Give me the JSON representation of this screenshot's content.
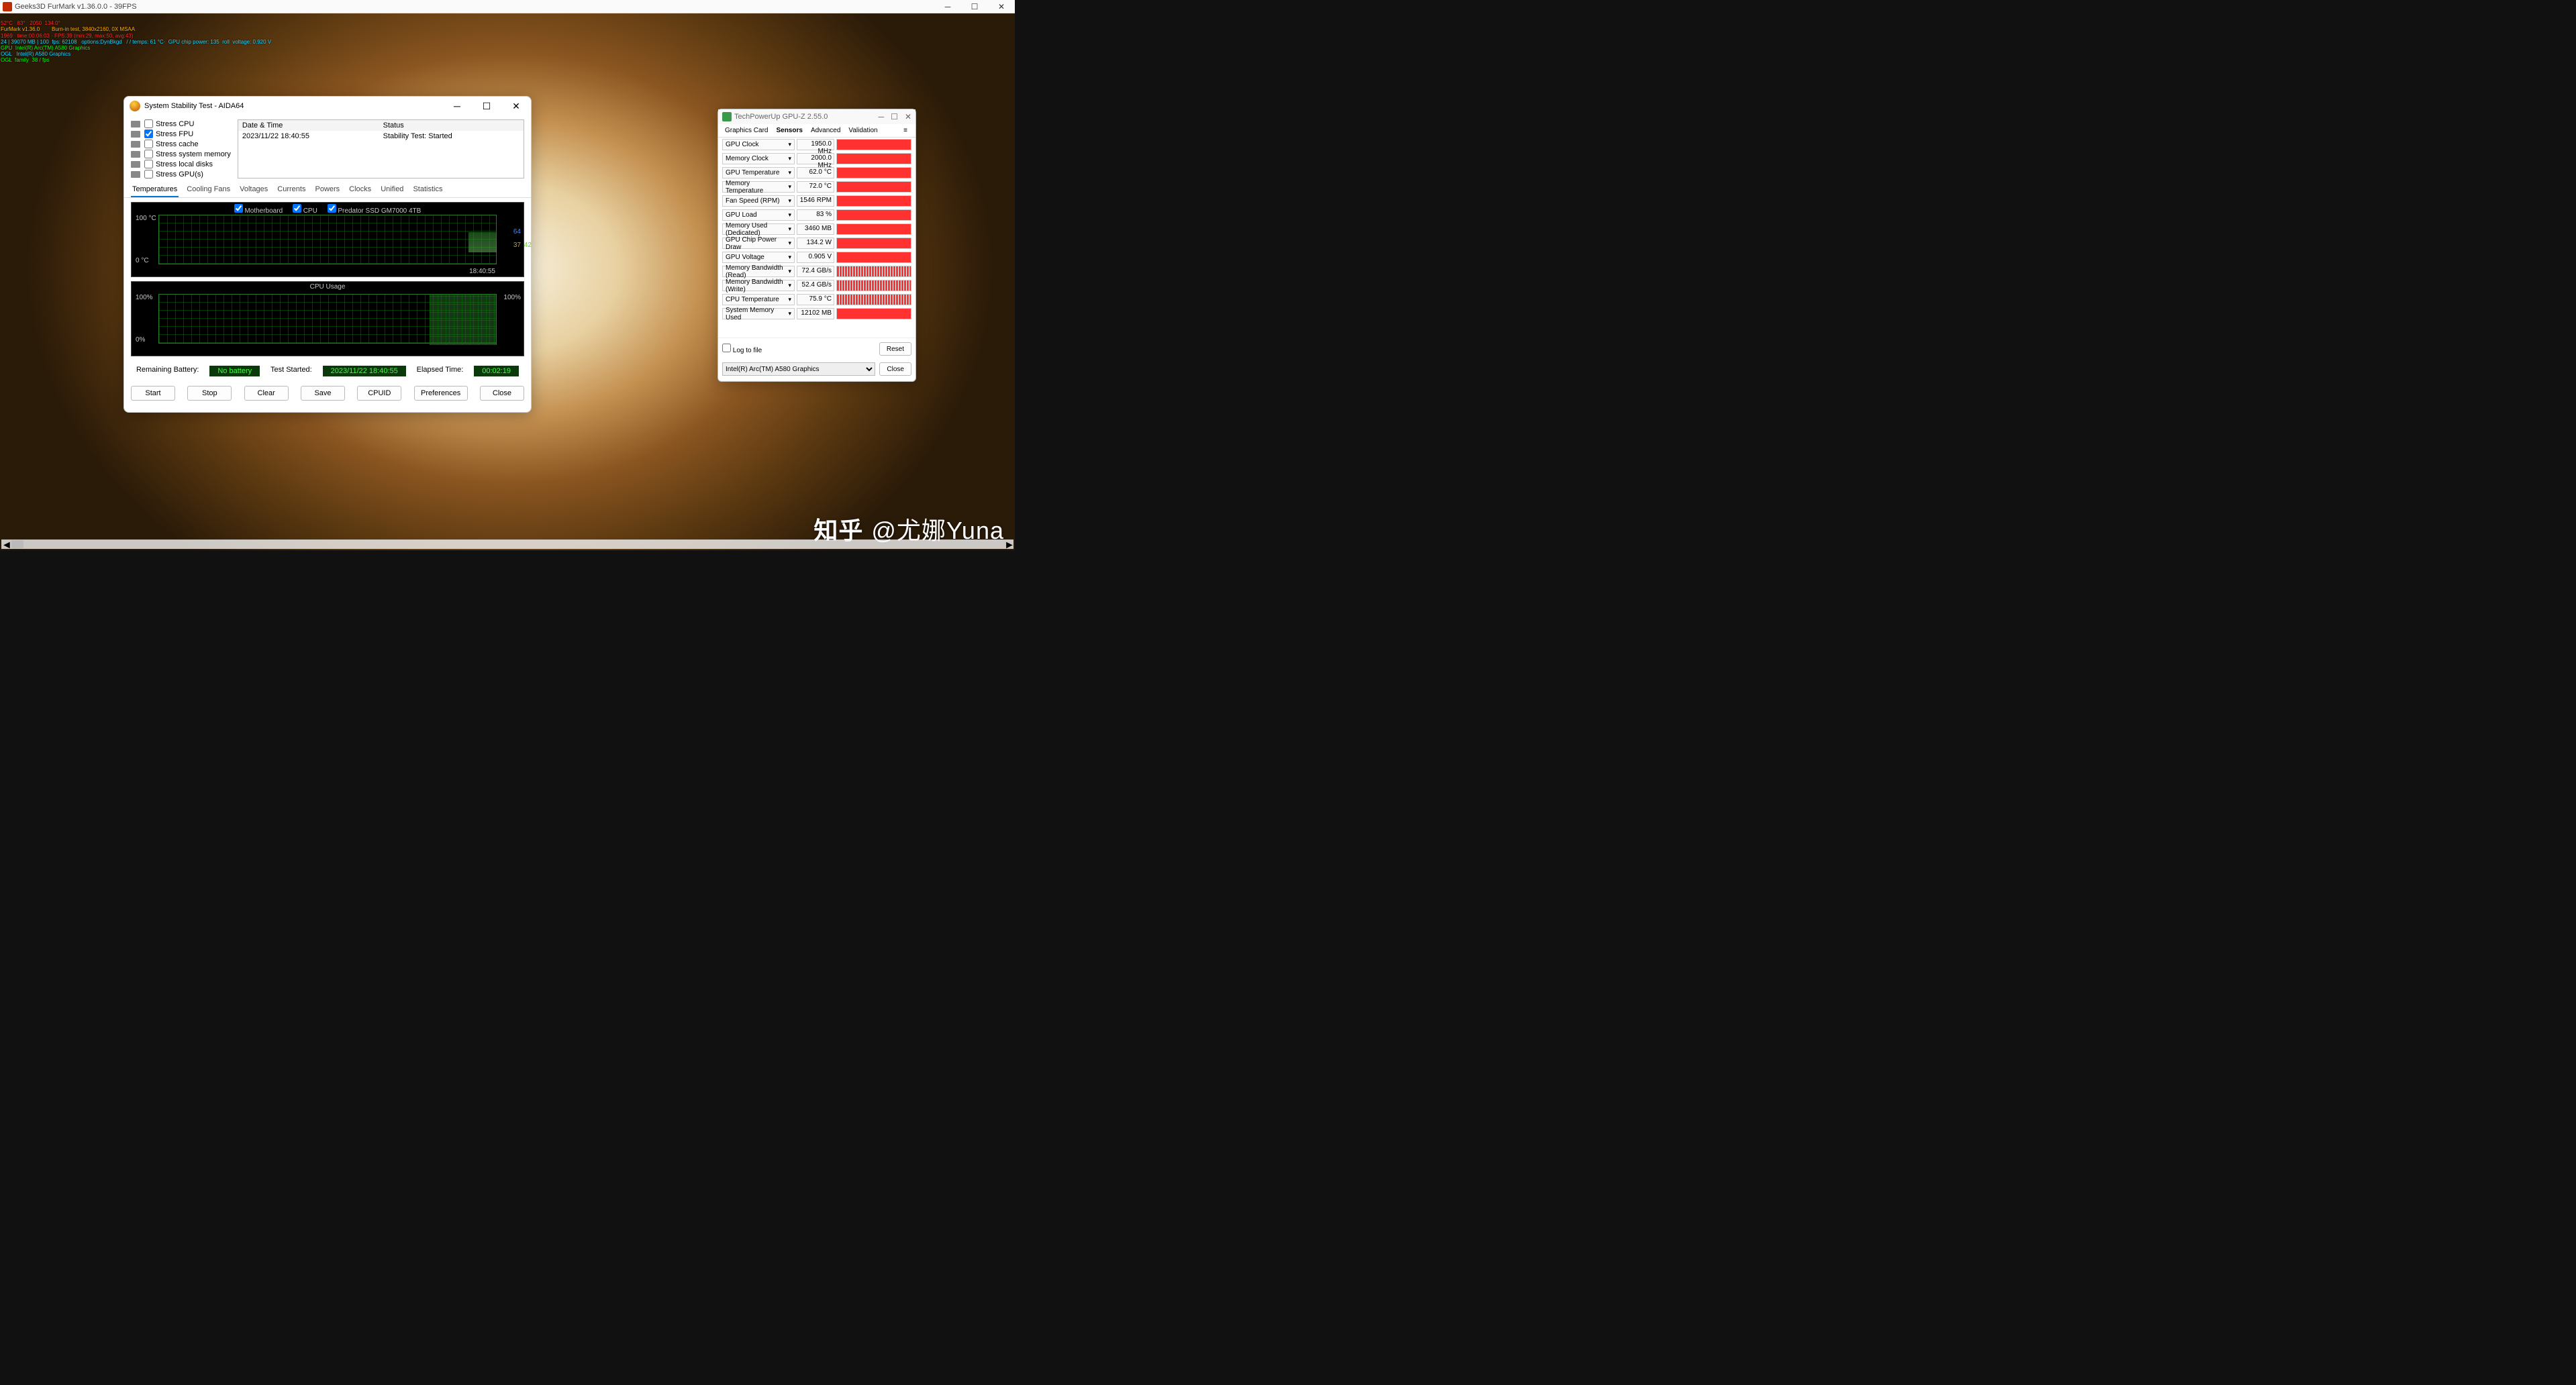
{
  "titlebar": {
    "text": "Geeks3D FurMark v1.36.0.0 - 39FPS"
  },
  "overlay": {
    "l1": "52°C   83°   2050  134.0°",
    "l2": "FurMark v1.36.0        Burn-in test, 3840x2160, 0X MSAA",
    "l3": "1969   time:00:06:03 · FPS:39 (min:29, max:50, avg:43)",
    "l4": "24 | 39070 MB | 100  fps: 62108   options:DynBkgd   / / temps: 61 °C·  GPU chip power: 135  roll  voltage: 0.920 V",
    "l5": "GPU  Intel(R) Arc(TM) A580 Graphics",
    "l6": "OGL   Intel(R) A580 Graphics",
    "l7": "OGL  family  38 / fps"
  },
  "aida": {
    "title": "System Stability Test - AIDA64",
    "stress": {
      "cpu": "Stress CPU",
      "fpu": "Stress FPU",
      "cache": "Stress cache",
      "mem": "Stress system memory",
      "disks": "Stress local disks",
      "gpus": "Stress GPU(s)"
    },
    "log": {
      "h1": "Date & Time",
      "h2": "Status",
      "r1c1": "2023/11/22 18:40:55",
      "r1c2": "Stability Test: Started"
    },
    "tabs": {
      "temps": "Temperatures",
      "fans": "Cooling Fans",
      "volt": "Voltages",
      "cur": "Currents",
      "pow": "Powers",
      "clk": "Clocks",
      "uni": "Unified",
      "stat": "Statistics"
    },
    "chart1": {
      "legend_mb": "Motherboard",
      "legend_cpu": "CPU",
      "legend_ssd": "Predator SSD GM7000 4TB",
      "ytop": "100 °C",
      "ybot": "0 °C",
      "x": "18:40:55",
      "v1": "64",
      "v2": "37",
      "v3": "42"
    },
    "chart2": {
      "title": "CPU Usage",
      "ytop": "100%",
      "ybot": "0%",
      "val": "100%"
    },
    "status": {
      "bat_l": "Remaining Battery:",
      "bat_v": "No battery",
      "ts_l": "Test Started:",
      "ts_v": "2023/11/22 18:40:55",
      "el_l": "Elapsed Time:",
      "el_v": "00:02:19"
    },
    "buttons": {
      "start": "Start",
      "stop": "Stop",
      "clear": "Clear",
      "save": "Save",
      "cpuid": "CPUID",
      "prefs": "Preferences",
      "close": "Close"
    }
  },
  "gpuz": {
    "title": "TechPowerUp GPU-Z 2.55.0",
    "tabs": {
      "gc": "Graphics Card",
      "sen": "Sensors",
      "adv": "Advanced",
      "val": "Validation",
      "ham": "≡"
    },
    "rows": [
      {
        "l": "GPU Clock",
        "v": "1950.0 MHz"
      },
      {
        "l": "Memory Clock",
        "v": "2000.0 MHz"
      },
      {
        "l": "GPU Temperature",
        "v": "62.0 °C"
      },
      {
        "l": "Memory Temperature",
        "v": "72.0 °C"
      },
      {
        "l": "Fan Speed (RPM)",
        "v": "1546 RPM"
      },
      {
        "l": "GPU Load",
        "v": "83 %"
      },
      {
        "l": "Memory Used (Dedicated)",
        "v": "3460 MB"
      },
      {
        "l": "GPU Chip Power Draw",
        "v": "134.2 W"
      },
      {
        "l": "GPU Voltage",
        "v": "0.905 V"
      },
      {
        "l": "Memory Bandwidth (Read)",
        "v": "72.4 GB/s"
      },
      {
        "l": "Memory Bandwidth (Write)",
        "v": "52.4 GB/s"
      },
      {
        "l": "CPU Temperature",
        "v": "75.9 °C"
      },
      {
        "l": "System Memory Used",
        "v": "12102 MB"
      }
    ],
    "log": "Log to file",
    "reset": "Reset",
    "device": "Intel(R) Arc(TM) A580 Graphics",
    "close": "Close"
  },
  "watermark": {
    "brand": "知乎",
    "handle": "@尤娜Yuna"
  },
  "chart_data": [
    {
      "type": "line",
      "title": "Temperatures",
      "series": [
        {
          "name": "Motherboard",
          "values": [
            37
          ]
        },
        {
          "name": "CPU",
          "values": [
            64
          ]
        },
        {
          "name": "Predator SSD GM7000 4TB",
          "values": [
            42
          ]
        }
      ],
      "ylim": [
        0,
        100
      ],
      "ylabel": "°C",
      "xlabel": "18:40:55"
    },
    {
      "type": "area",
      "title": "CPU Usage",
      "series": [
        {
          "name": "CPU",
          "values": [
            0,
            0,
            0,
            0,
            100,
            100
          ]
        }
      ],
      "ylim": [
        0,
        100
      ],
      "ylabel": "%"
    }
  ]
}
